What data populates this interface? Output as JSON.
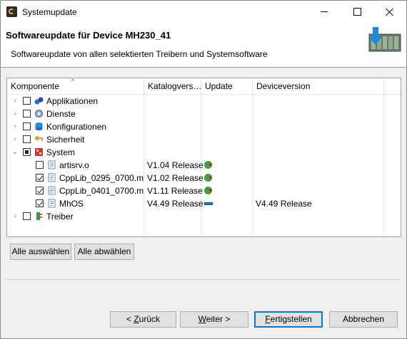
{
  "window": {
    "title": "Systemupdate"
  },
  "header": {
    "title": "Softwareupdate für Device MH230_41",
    "description": "Softwareupdate von allen selektierten Treibern und Systemsoftware"
  },
  "table": {
    "columns": [
      "Komponente",
      "Katalogvers…",
      "Update",
      "Deviceversion"
    ],
    "rows": [
      {
        "label": "Applikationen",
        "expander": "›",
        "check": "unchecked",
        "icon": "applications-icon",
        "catalog": "",
        "update": "",
        "device": ""
      },
      {
        "label": "Dienste",
        "expander": "›",
        "check": "unchecked",
        "icon": "services-icon",
        "catalog": "",
        "update": "",
        "device": ""
      },
      {
        "label": "Konfigurationen",
        "expander": "›",
        "check": "unchecked",
        "icon": "configurations-icon",
        "catalog": "",
        "update": "",
        "device": ""
      },
      {
        "label": "Sicherheit",
        "expander": "›",
        "check": "unchecked",
        "icon": "security-key-icon",
        "catalog": "",
        "update": "",
        "device": ""
      },
      {
        "label": "System",
        "expander": "⌄",
        "check": "partial",
        "icon": "system-icon",
        "catalog": "",
        "update": "",
        "device": ""
      },
      {
        "label": "artisrv.o",
        "expander": "",
        "check": "unchecked",
        "icon": "file-icon",
        "catalog": "V1.04 Release",
        "update": "green-plus-icon",
        "device": ""
      },
      {
        "label": "CppLib_0295_0700.m",
        "expander": "",
        "check": "checked",
        "icon": "file-icon",
        "catalog": "V1.02 Release",
        "update": "green-plus-icon",
        "device": ""
      },
      {
        "label": "CppLib_0401_0700.m",
        "expander": "",
        "check": "checked",
        "icon": "file-icon",
        "catalog": "V1.11 Release",
        "update": "green-plus-icon",
        "device": ""
      },
      {
        "label": "MhOS",
        "expander": "",
        "check": "checked",
        "icon": "file-icon",
        "catalog": "V4.49 Release",
        "update": "blue-bar-icon",
        "device": "V4.49 Release"
      },
      {
        "label": "Treiber",
        "expander": "›",
        "check": "unchecked",
        "icon": "drivers-icon",
        "catalog": "",
        "update": "",
        "device": ""
      }
    ]
  },
  "selection_buttons": {
    "select_all": "Alle auswählen",
    "deselect_all": "Alle abwählen"
  },
  "footer_buttons": {
    "back_mnemonic": "Z",
    "back_rest": "urück",
    "back_prefix": "< ",
    "next_mnemonic": "W",
    "next_rest": "eiter >",
    "finish_mnemonic": "F",
    "finish_rest": "ertigstellen",
    "cancel": "Abbrechen"
  }
}
